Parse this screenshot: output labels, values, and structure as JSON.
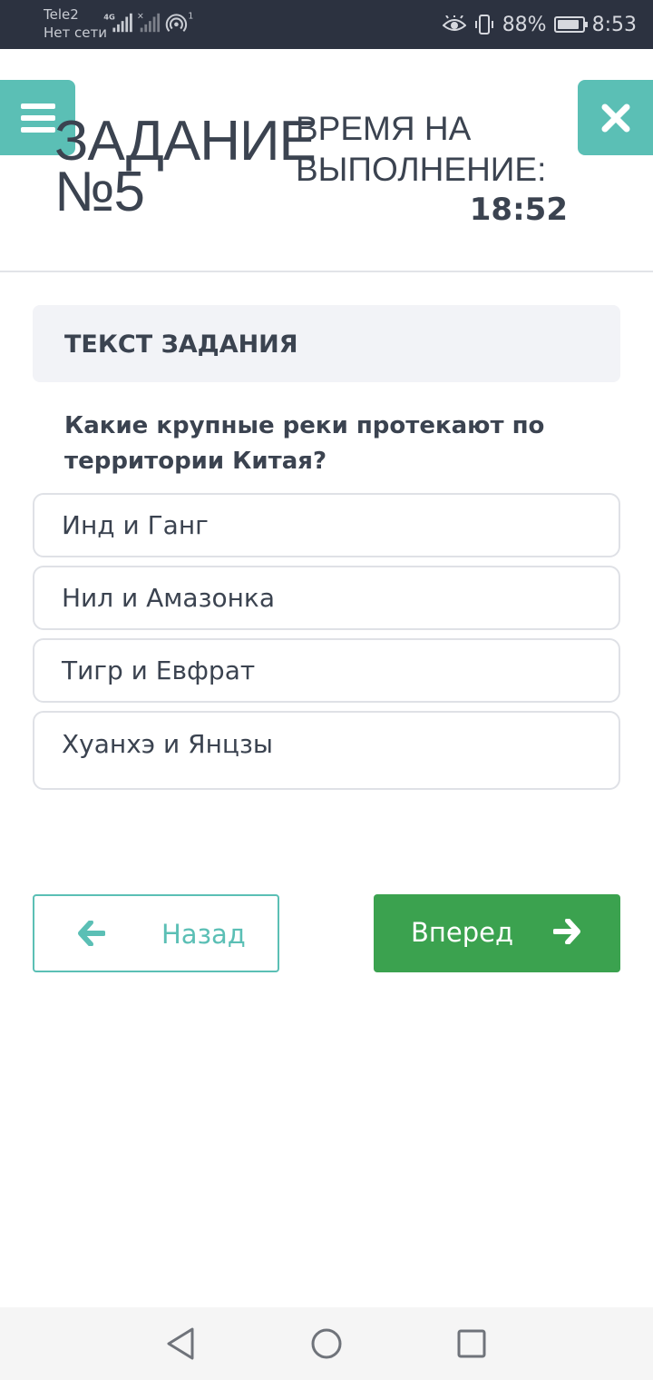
{
  "status_bar": {
    "carrier": "Tele2",
    "network_status": "Нет сети",
    "network_type": "4G",
    "notification_count": "1",
    "battery_level": 0.88,
    "battery_text": "88%",
    "time": "8:53",
    "icons": [
      "signal-icon",
      "no-signal-icon",
      "hotspot-icon",
      "eye-comfort-icon",
      "vibrate-icon",
      "battery-icon"
    ]
  },
  "header": {
    "menu_icon": "hamburger-icon",
    "close_icon": "close-icon",
    "task_title": "ЗАДАНИЕ №5",
    "time_label": "ВРЕМЯ НА ВЫПОЛНЕНИЕ:",
    "time_value": "18:52"
  },
  "task": {
    "section_title": "ТЕКСТ ЗАДАНИЯ",
    "question": "Какие крупные реки протекают по территории Китая?",
    "options": [
      {
        "label": "Инд и Ганг"
      },
      {
        "label": "Нил и Амазонка"
      },
      {
        "label": "Тигр и Евфрат"
      },
      {
        "label": "Хуанхэ и Янцзы"
      }
    ]
  },
  "navigation": {
    "back_label": "Назад",
    "next_label": "Вперед",
    "back_icon": "arrow-left-icon",
    "next_icon": "arrow-right-icon"
  },
  "system_nav": {
    "items": [
      "back-triangle-icon",
      "home-circle-icon",
      "recents-square-icon"
    ]
  },
  "colors": {
    "accent": "#5bbfb5",
    "primary_button": "#3ba24f",
    "text": "#3b4350",
    "status_bar": "#2c3240"
  }
}
